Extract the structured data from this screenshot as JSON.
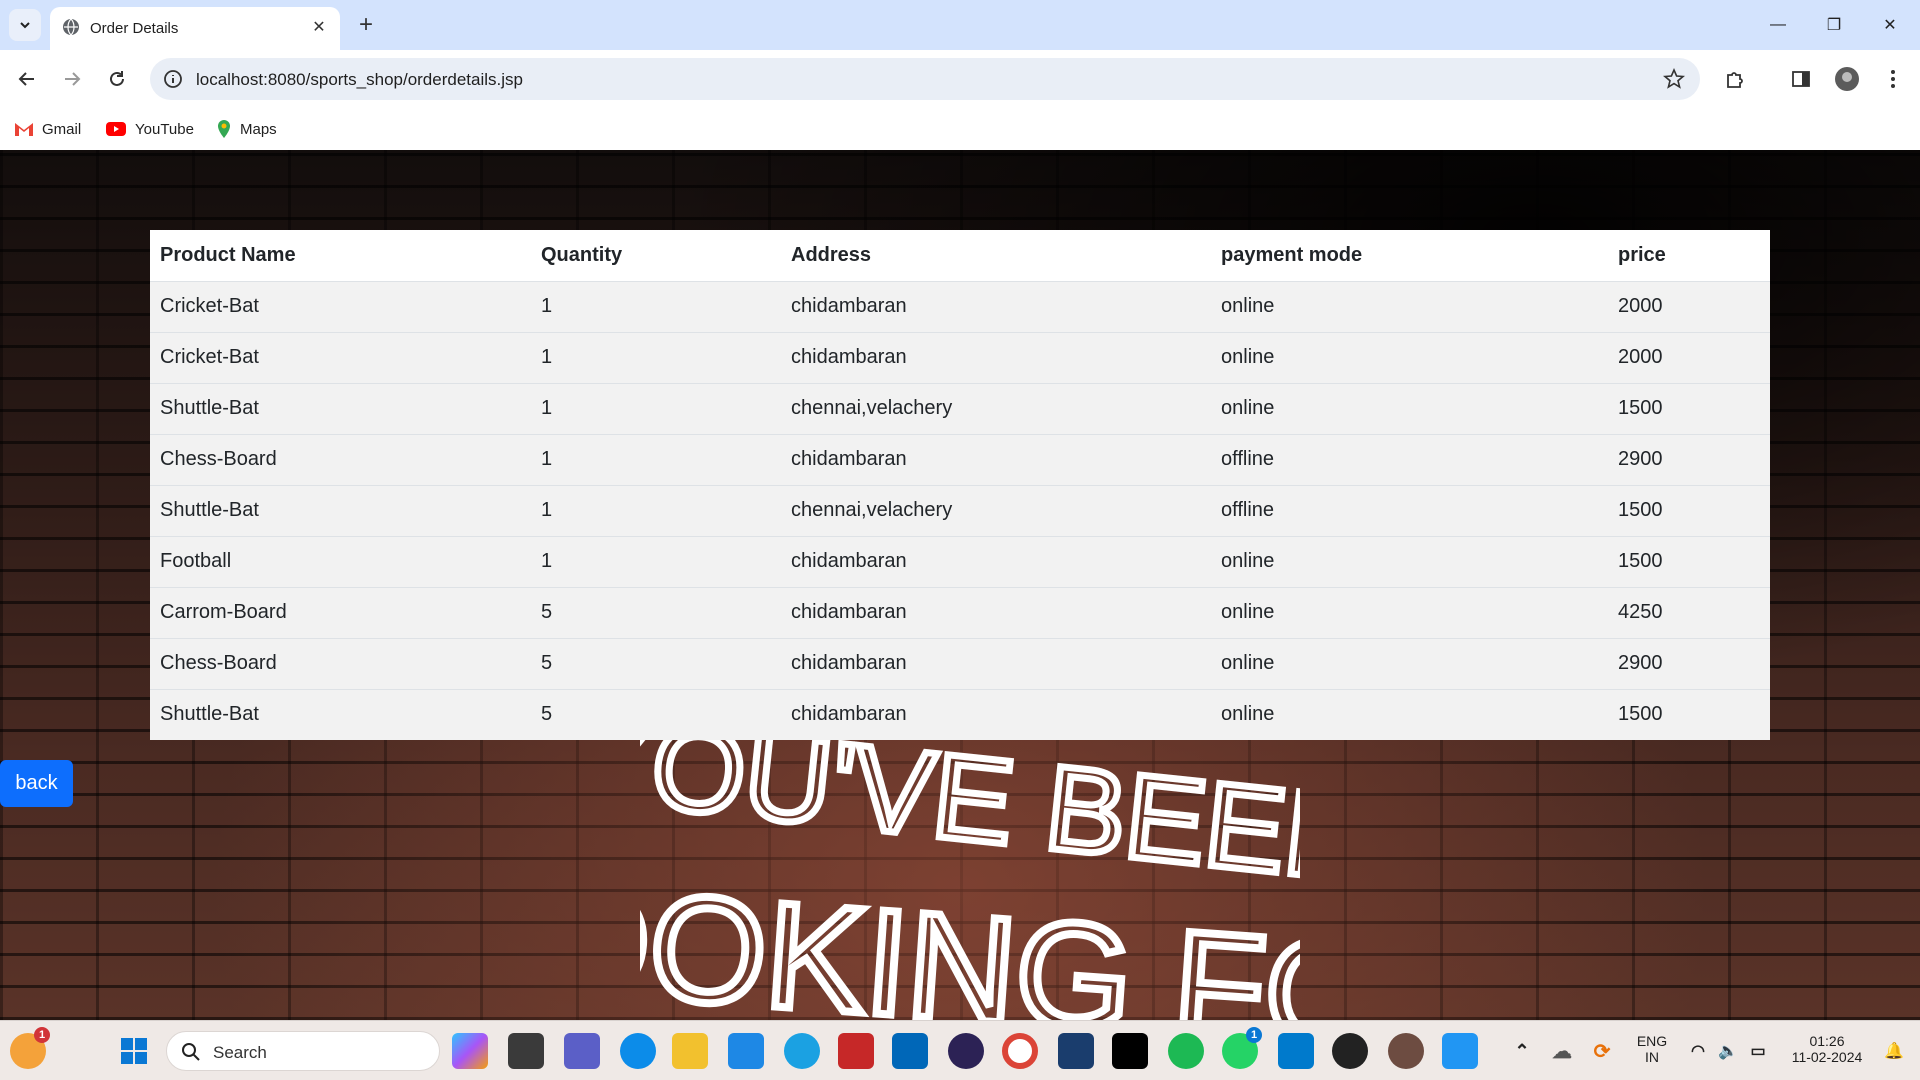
{
  "browser": {
    "tab_title": "Order Details",
    "url": "localhost:8080/sports_shop/orderdetails.jsp",
    "bookmarks": [
      {
        "label": "Gmail",
        "icon": "gmail-icon"
      },
      {
        "label": "YouTube",
        "icon": "youtube-icon"
      },
      {
        "label": "Maps",
        "icon": "maps-icon"
      }
    ]
  },
  "table": {
    "headers": [
      "Product Name",
      "Quantity",
      "Address",
      "payment mode",
      "price"
    ],
    "rows": [
      [
        "Cricket-Bat",
        "1",
        "chidambaran",
        "online",
        "2000"
      ],
      [
        "Cricket-Bat",
        "1",
        "chidambaran",
        "online",
        "2000"
      ],
      [
        "Shuttle-Bat",
        "1",
        "chennai,velachery",
        "online",
        "1500"
      ],
      [
        "Chess-Board",
        "1",
        "chidambaran",
        "offline",
        "2900"
      ],
      [
        "Shuttle-Bat",
        "1",
        "chennai,velachery",
        "offline",
        "1500"
      ],
      [
        "Football",
        "1",
        "chidambaran",
        "online",
        "1500"
      ],
      [
        "Carrom-Board",
        "5",
        "chidambaran",
        "online",
        "4250"
      ],
      [
        "Chess-Board",
        "5",
        "chidambaran",
        "online",
        "2900"
      ],
      [
        "Shuttle-Bat",
        "5",
        "chidambaran",
        "online",
        "1500"
      ]
    ]
  },
  "back_button": "back",
  "background_neon_text": "YOU'VE BEEN LOOKING FOR",
  "taskbar": {
    "search_placeholder": "Search",
    "language_line1": "ENG",
    "language_line2": "IN",
    "time": "01:26",
    "date": "11-02-2024",
    "notification_badge": "1",
    "whatsapp_badge": "1"
  },
  "colors": {
    "tabstrip": "#d3e3fd",
    "back_button": "#0d6efd",
    "table_row": "#f2f2f2"
  }
}
